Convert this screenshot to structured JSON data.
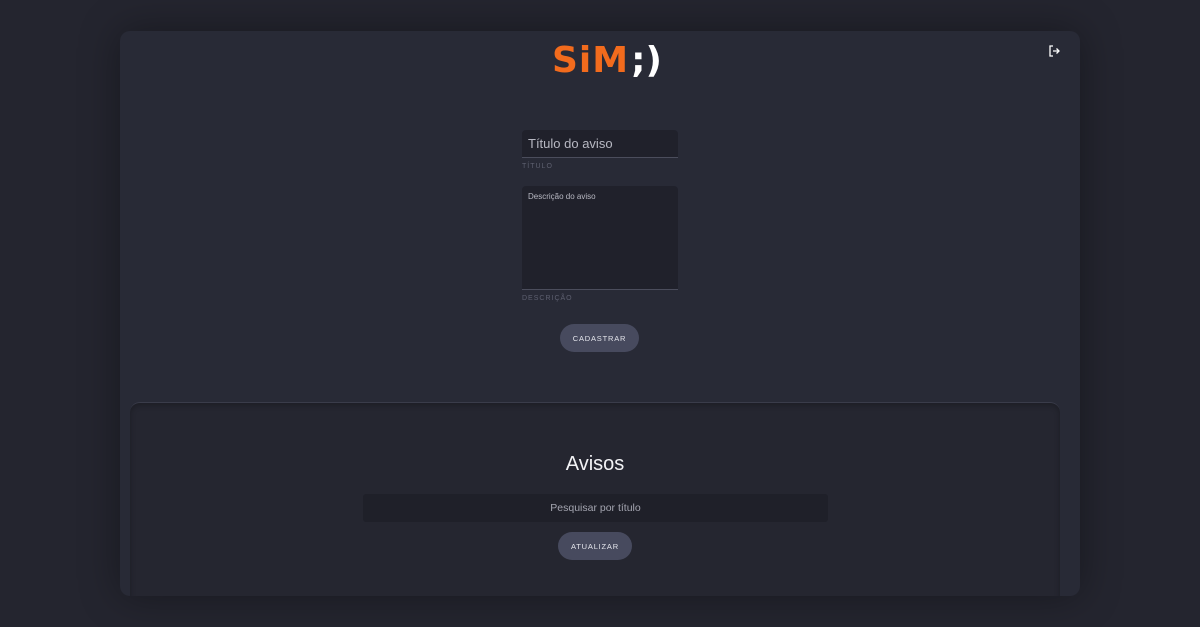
{
  "header": {
    "logo_text": "SiM",
    "logo_smile": ";)",
    "logout_icon": "logout-icon"
  },
  "form": {
    "title_placeholder": "Título do aviso",
    "title_value": "",
    "title_label": "TÍTULO",
    "description_placeholder": "Descrição do aviso",
    "description_value": "",
    "description_label": "DESCRIÇÃO",
    "register_label": "CADASTRAR"
  },
  "notices": {
    "heading": "Avisos",
    "search_placeholder": "Pesquisar por título",
    "search_value": "",
    "update_label": "ATUALIZAR"
  },
  "colors": {
    "page_background": "#24252f",
    "card_background": "#282a36",
    "accent": "#f26b1d",
    "button_background": "#474a5e"
  }
}
